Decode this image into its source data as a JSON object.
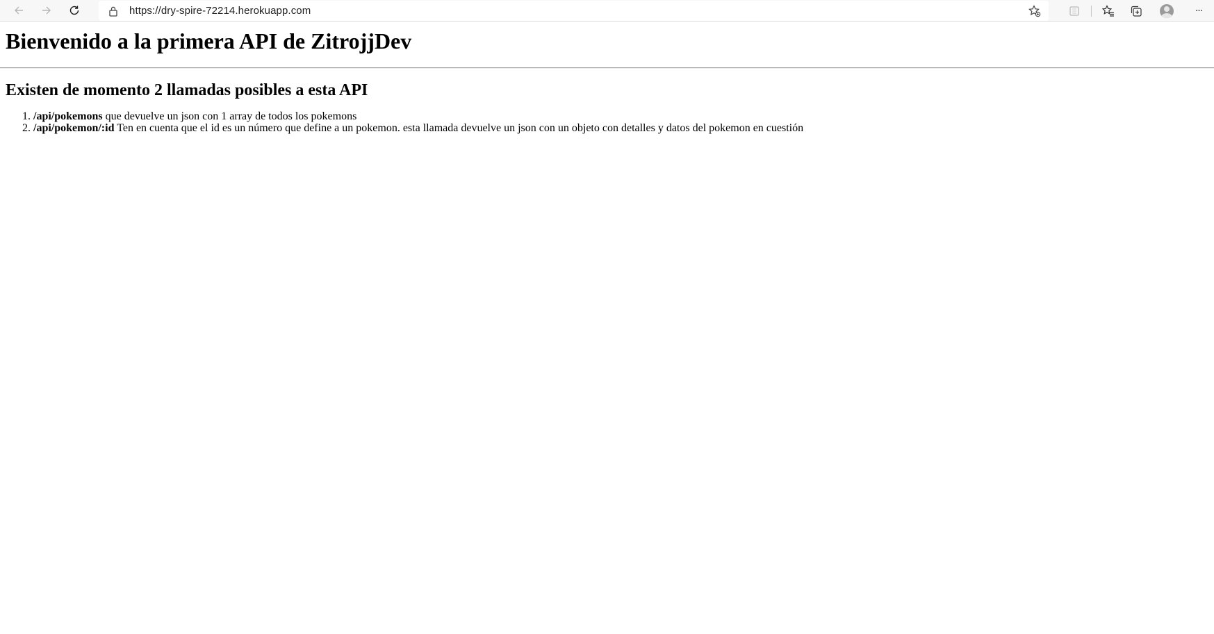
{
  "browser": {
    "url": "https://dry-spire-72214.herokuapp.com",
    "back_icon": "back-arrow-icon",
    "forward_icon": "forward-arrow-icon",
    "reload_icon": "reload-icon",
    "lock_icon": "lock-icon",
    "add_favorite_icon": "star-add-icon",
    "extension_icon": "extension-icon",
    "favorites_icon": "favorites-icon",
    "collections_icon": "collections-icon",
    "profile_icon": "avatar",
    "menu_label": "···"
  },
  "page": {
    "title": "Bienvenido a la primera API de ZitrojjDev",
    "subtitle": "Existen de momento 2 llamadas posibles a esta API",
    "items": [
      {
        "code": "/api/pokemons",
        "description": " que devuelve un json con 1 array de todos los pokemons"
      },
      {
        "code": "/api/pokemon/:id",
        "description": " Ten en cuenta que el id es un número que define a un pokemon. esta llamada devuelve un json con un objeto con detalles y datos del pokemon en cuestión"
      }
    ]
  }
}
